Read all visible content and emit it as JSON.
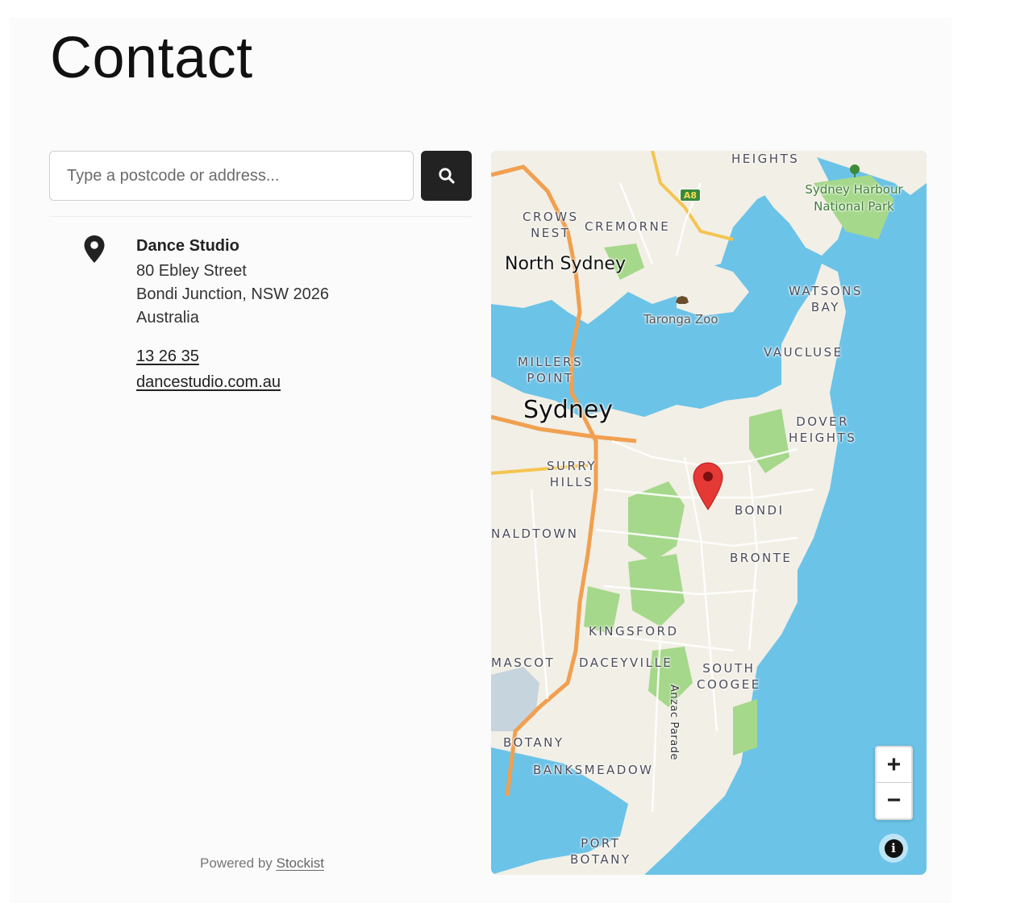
{
  "page": {
    "title": "Contact"
  },
  "search": {
    "placeholder": "Type a postcode or address...",
    "button_icon": "search-icon"
  },
  "result": {
    "icon": "map-pin-icon",
    "name": "Dance Studio",
    "address_lines": [
      "80 Ebley Street",
      "Bondi Junction, NSW 2026",
      "Australia"
    ],
    "phone": "13 26 35",
    "website": "dancestudio.com.au"
  },
  "footer": {
    "powered_prefix": "Powered by ",
    "powered_link": "Stockist"
  },
  "map": {
    "labels": {
      "heights": "HEIGHTS",
      "a8_badge": "A8",
      "harbour_park_1": "Sydney Harbour",
      "harbour_park_2": "National Park",
      "crows_nest_1": "CROWS",
      "crows_nest_2": "NEST",
      "cremorne": "CREMORNE",
      "north_sydney": "North Sydney",
      "taronga_zoo": "Taronga Zoo",
      "watsons_bay_1": "WATSONS",
      "watsons_bay_2": "BAY",
      "vaucluse": "VAUCLUSE",
      "millers_point_1": "MILLERS",
      "millers_point_2": "POINT",
      "sydney": "Sydney",
      "dover_heights_1": "DOVER",
      "dover_heights_2": "HEIGHTS",
      "surry_hills_1": "SURRY",
      "surry_hills_2": "HILLS",
      "bondi": "BONDI",
      "waterloo": "NALDTOWN",
      "bronte": "BRONTE",
      "kingsford": "KINGSFORD",
      "mascot": "MASCOT",
      "daceyville": "DACEYVILLE",
      "south_coogee_1": "SOUTH",
      "south_coogee_2": "COOGEE",
      "anzac_parade": "Anzac Parade",
      "botany": "BOTANY",
      "banksmeadow": "BANKSMEADOW",
      "port_botany_1": "PORT",
      "port_botany_2": "BOTANY"
    },
    "zoom_in": "+",
    "zoom_out": "−",
    "info": "i",
    "colors": {
      "water": "#6bc3e8",
      "land": "#f2efe6",
      "park": "#a5d88a",
      "road_major": "#f0a050",
      "marker": "#e53935"
    }
  }
}
